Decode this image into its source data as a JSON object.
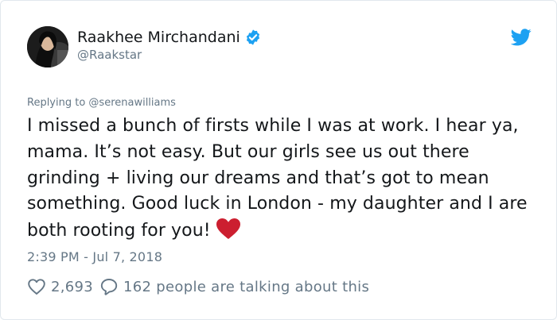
{
  "author": {
    "display_name": "Raakhee Mirchandani",
    "handle": "@Raakstar",
    "verified": true
  },
  "icons": {
    "avatar": "avatar-photo",
    "verified": "verified-badge-icon",
    "brand": "twitter-bird-icon",
    "like": "heart-outline-icon",
    "reply": "speech-bubble-icon",
    "emoji": "red-heart-emoji"
  },
  "tweet": {
    "replying_to": "Replying to @serenawilliams",
    "text": "I missed a bunch of firsts while I was at work. I hear ya, mama. It’s not easy. But our girls see us out there grinding + living our dreams and that’s got to mean something. Good luck in London - my daughter and I are both rooting for you!",
    "timestamp": "2:39 PM - Jul 7, 2018",
    "like_count": "2,693",
    "talking": "162 people are talking about this"
  },
  "colors": {
    "brand_blue": "#1da1f2",
    "text_primary": "#14171a",
    "text_secondary": "#657786",
    "heart_red": "#cc1f30"
  }
}
